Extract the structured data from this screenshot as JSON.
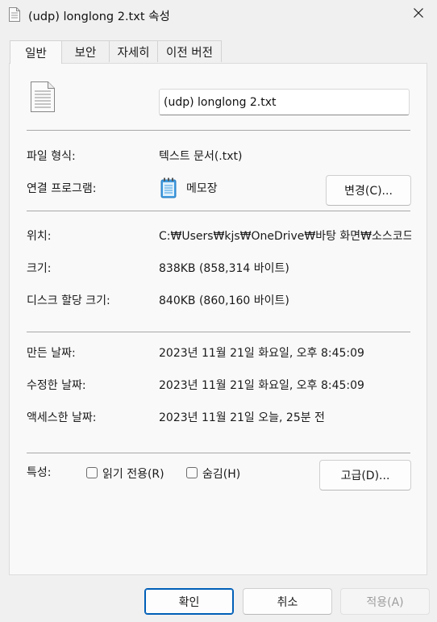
{
  "window": {
    "title": "(udp) longlong 2.txt 속성"
  },
  "tabs": [
    {
      "label": "일반",
      "active": true
    },
    {
      "label": "보안",
      "active": false
    },
    {
      "label": "자세히",
      "active": false
    },
    {
      "label": "이전 버전",
      "active": false
    }
  ],
  "general": {
    "filename": "(udp) longlong 2.txt",
    "file_type_label": "파일 형식:",
    "file_type_value": "텍스트 문서(.txt)",
    "opens_with_label": "연결 프로그램:",
    "opens_with_value": "메모장",
    "change_button": "변경(C)...",
    "location_label": "위치:",
    "location_value": "C:₩Users₩kjs₩OneDrive₩바탕 화면₩소스코드₩",
    "size_label": "크기:",
    "size_value": "838KB (858,314 바이트)",
    "size_on_disk_label": "디스크 할당 크기:",
    "size_on_disk_value": "840KB (860,160 바이트)",
    "created_label": "만든 날짜:",
    "created_value": "2023년 11월 21일 화요일, 오후 8:45:09",
    "modified_label": "수정한 날짜:",
    "modified_value": "2023년 11월 21일 화요일, 오후 8:45:09",
    "accessed_label": "액세스한 날짜:",
    "accessed_value": "2023년 11월 21일 오늘, 25분 전",
    "attributes_label": "특성:",
    "readonly_label": "읽기 전용(R)",
    "readonly_checked": false,
    "hidden_label": "숨김(H)",
    "hidden_checked": false,
    "advanced_button": "고급(D)..."
  },
  "footer": {
    "ok": "확인",
    "cancel": "취소",
    "apply": "적용(A)"
  },
  "icons": {
    "document": "document-icon",
    "notepad": "notepad-icon",
    "close": "close-icon"
  },
  "colors": {
    "accent": "#005fb8",
    "disabled_text": "#9d9d9d"
  }
}
